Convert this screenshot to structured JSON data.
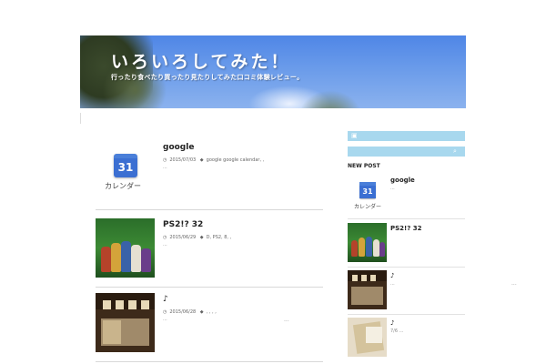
{
  "header": {
    "site_title": "いろいろしてみた！",
    "tagline": "行ったり食べたり買ったり見たりしてみた口コミ体験レビュー。"
  },
  "posts": [
    {
      "title": "google",
      "date": "2015/07/03",
      "tags": "google google calendar, ,",
      "excerpt": "...",
      "thumb_icon": "calendar-icon",
      "thumb_number": "31",
      "thumb_caption": "カレンダー"
    },
    {
      "title": "PS2!? 32",
      "date": "2015/06/29",
      "tags": "D, PS2, 8, ,",
      "excerpt": "...",
      "thumb_icon": "figures-photo"
    },
    {
      "title": "♪",
      "date": "2015/06/28",
      "tags": ", , , ,",
      "excerpt": "...",
      "thumb_icon": "shop-photo"
    }
  ],
  "sidebar": {
    "bar1_icon": "image-icon",
    "bar2_icon": "search-icon",
    "new_post_heading": "NEW POST",
    "items": [
      {
        "title": "google",
        "excerpt": "...",
        "thumb_number": "31",
        "thumb_caption": "カレンダー"
      },
      {
        "title": "PS2!? 32",
        "excerpt": ""
      },
      {
        "title": "♪",
        "excerpt": "..."
      },
      {
        "title": "♪",
        "excerpt": "7/6 ..."
      }
    ]
  },
  "stray_marks": [
    "...",
    "..."
  ],
  "colors": {
    "banner": "#5b8fe8",
    "sidebar_bar": "#a8d8ee",
    "calendar_blue": "#3b6fd2"
  }
}
